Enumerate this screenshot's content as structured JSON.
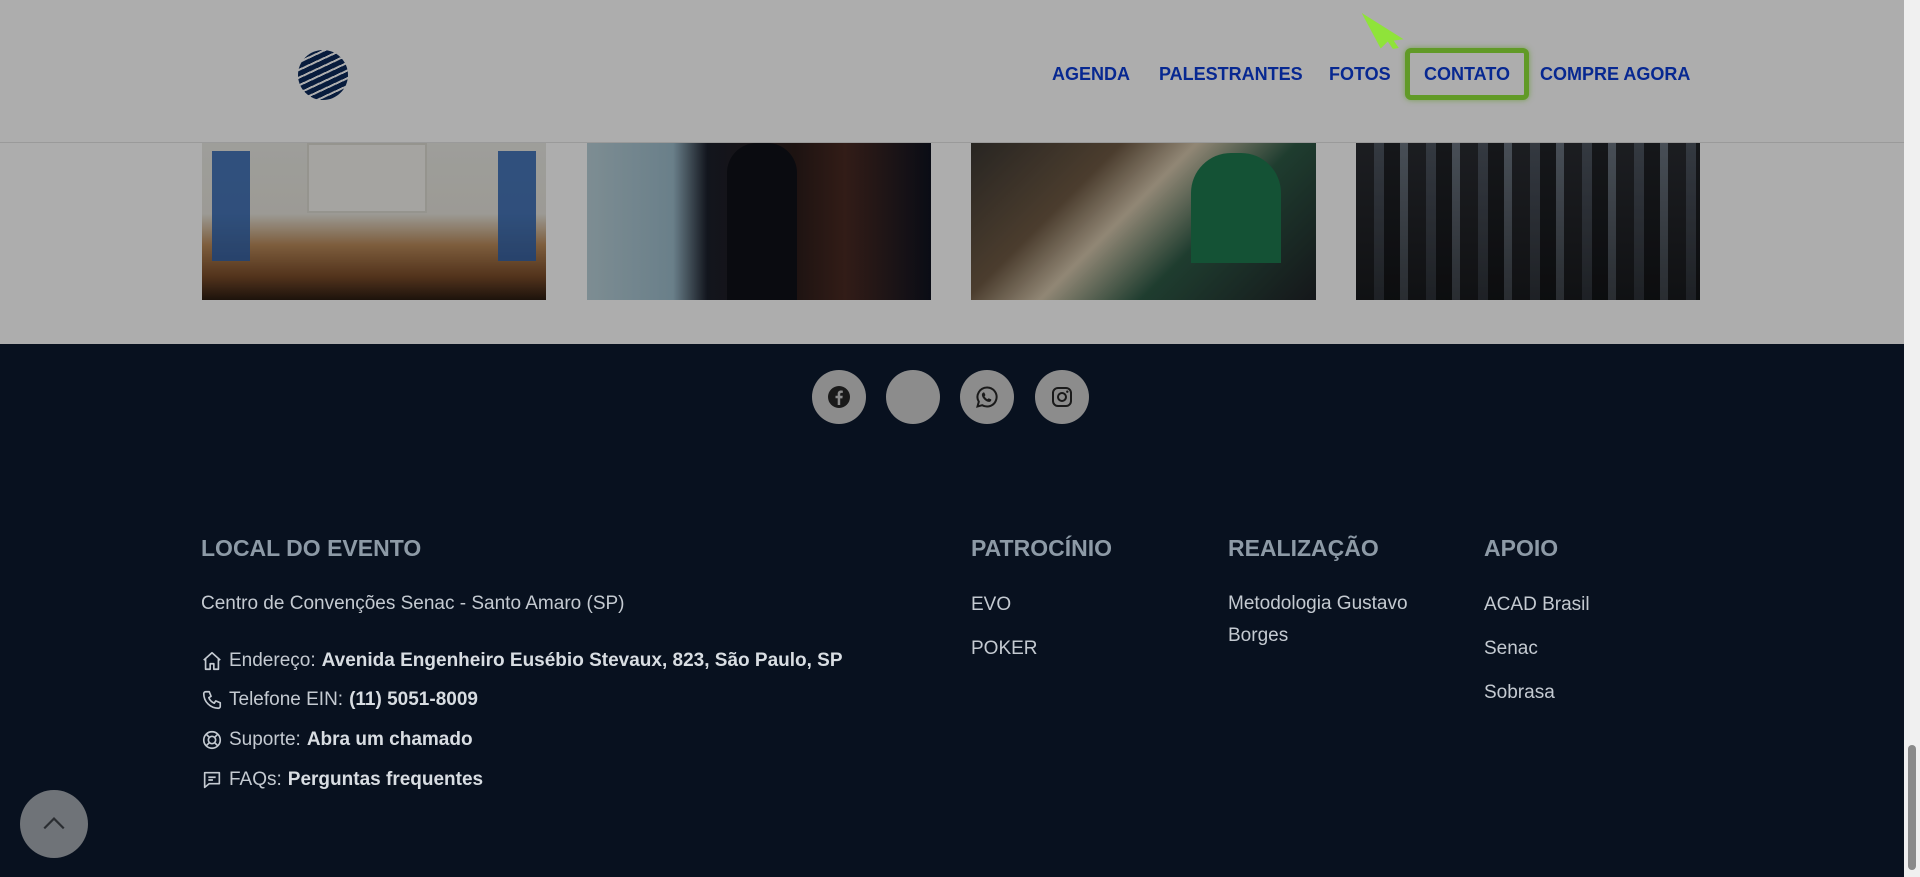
{
  "nav": {
    "items": [
      {
        "label": "AGENDA"
      },
      {
        "label": "PALESTRANTES"
      },
      {
        "label": "FOTOS"
      },
      {
        "label": "CONTATO"
      },
      {
        "label": "COMPRE AGORA"
      }
    ],
    "active_index": 3
  },
  "colors": {
    "nav_link": "#0b3bd6",
    "highlight": "#8fe33a",
    "footer_bg": "#08111f",
    "footer_heading": "#8d9aa6",
    "footer_text": "#c4cad1"
  },
  "social": [
    {
      "icon": "facebook-icon"
    },
    {
      "icon": "blank-icon"
    },
    {
      "icon": "whatsapp-icon"
    },
    {
      "icon": "instagram-icon"
    }
  ],
  "footer": {
    "local": {
      "title": "LOCAL DO EVENTO",
      "venue": "Centro de Convenções Senac - Santo Amaro (SP)",
      "address_label": "Endereço:",
      "address_value": "Avenida Engenheiro Eusébio Stevaux, 823, São Paulo, SP",
      "phone_label": "Telefone EIN:",
      "phone_value": "(11) 5051-8009",
      "support_label": "Suporte:",
      "support_value": "Abra um chamado",
      "faq_label": "FAQs:",
      "faq_value": "Perguntas frequentes"
    },
    "patrocinio": {
      "title": "PATROCÍNIO",
      "items": [
        "EVO",
        "POKER"
      ]
    },
    "realizacao": {
      "title": "REALIZAÇÃO",
      "items": [
        "Metodologia Gustavo Borges"
      ]
    },
    "apoio": {
      "title": "APOIO",
      "items": [
        "ACAD Brasil",
        "Senac",
        "Sobrasa"
      ]
    }
  }
}
